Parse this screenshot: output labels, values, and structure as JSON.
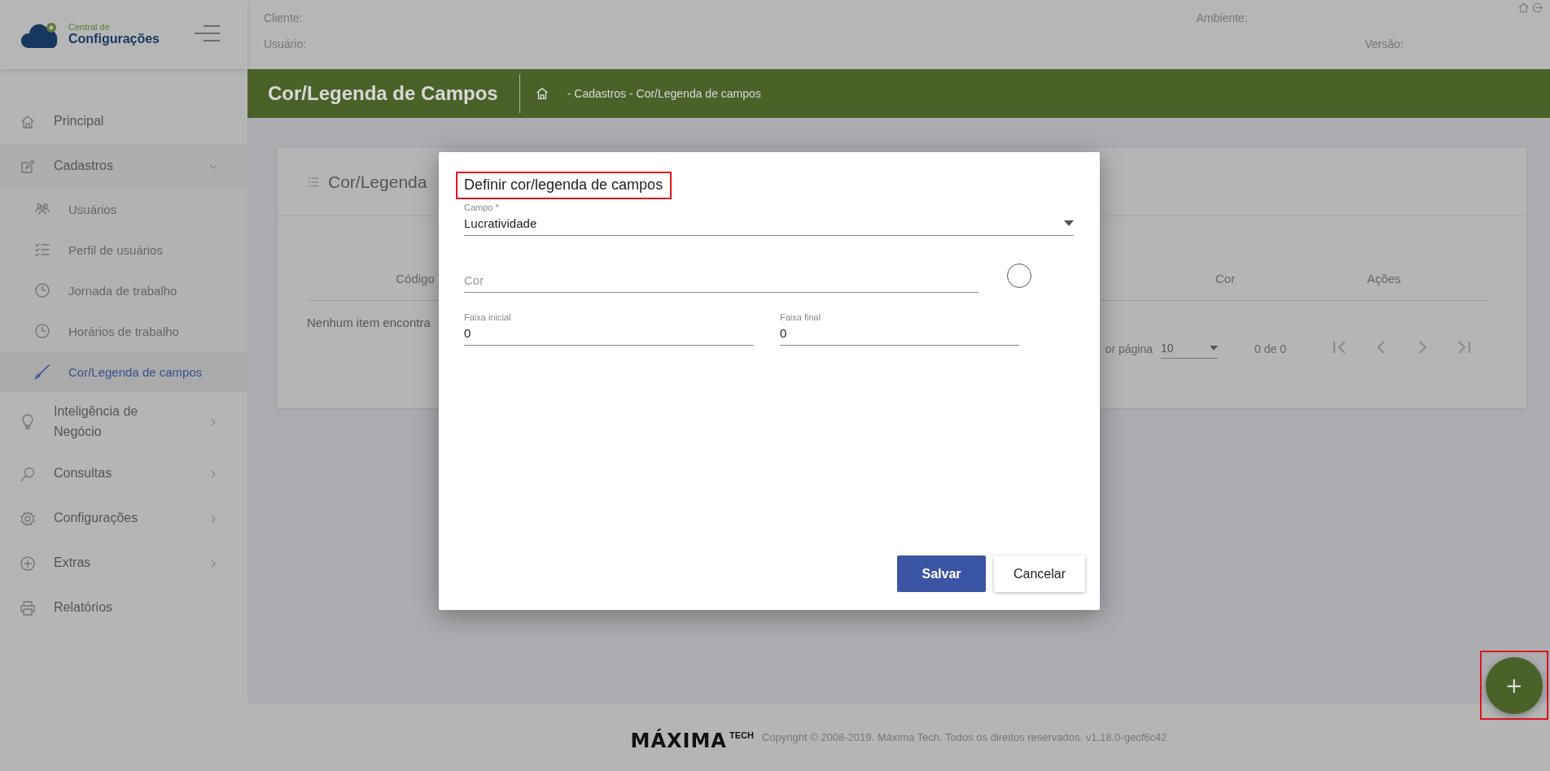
{
  "logo": {
    "small": "Central de",
    "big": "Configurações"
  },
  "header": {
    "left": [
      {
        "label": "Cliente:"
      },
      {
        "label": "Usuário:"
      }
    ],
    "right": [
      {
        "label": "Ambiente:"
      },
      {
        "label": "Versão:"
      }
    ]
  },
  "sidebar": {
    "items": [
      {
        "label": "Principal",
        "kind": "link"
      },
      {
        "label": "Cadastros",
        "kind": "group",
        "expanded": true,
        "children": [
          {
            "label": "Usuários",
            "selected": false
          },
          {
            "label": "Perfil de usuários",
            "selected": false
          },
          {
            "label": "Jornada de trabalho",
            "selected": false
          },
          {
            "label": "Horários de trabalho",
            "selected": false
          },
          {
            "label": "Cor/Legenda de campos",
            "selected": true
          }
        ]
      },
      {
        "label": "Inteligência de Negócio",
        "kind": "group",
        "expanded": false
      },
      {
        "label": "Consultas",
        "kind": "group",
        "expanded": false
      },
      {
        "label": "Configurações",
        "kind": "group",
        "expanded": false
      },
      {
        "label": "Extras",
        "kind": "group",
        "expanded": false
      },
      {
        "label": "Relatórios",
        "kind": "link"
      }
    ]
  },
  "page_bar": {
    "title": "Cor/Legenda de Campos",
    "breadcrumb": "- Cadastros - Cor/Legenda de campos"
  },
  "card": {
    "title": "Cor/Legenda",
    "table": {
      "columns": [
        {
          "label": "Código"
        },
        {
          "label": "Cor"
        },
        {
          "label": "Ações"
        }
      ],
      "empty_message": "Nenhum item encontra"
    },
    "paginator": {
      "label": "or página",
      "page_size": "10",
      "range": "0 de 0"
    }
  },
  "dialog": {
    "title": "Definir cor/legenda de campos",
    "campo": {
      "label": "Campo *",
      "value": "Lucratividade"
    },
    "cor": {
      "placeholder": "Cor"
    },
    "faixa_inicial": {
      "label": "Faixa inicial",
      "value": "0"
    },
    "faixa_final": {
      "label": "Faixa final",
      "value": "0"
    },
    "buttons": [
      {
        "label": "Salvar",
        "kind": "primary"
      },
      {
        "label": "Cancelar",
        "kind": "secondary"
      }
    ]
  },
  "fab": {
    "label": "+"
  },
  "footer": {
    "logo": "MÁXIMA",
    "logo_sub": "TECH",
    "copyright": "Copyright © 2008-2019. Máxima Tech. Todos os direitos reservados. v1.18.0-gecf6c42"
  }
}
